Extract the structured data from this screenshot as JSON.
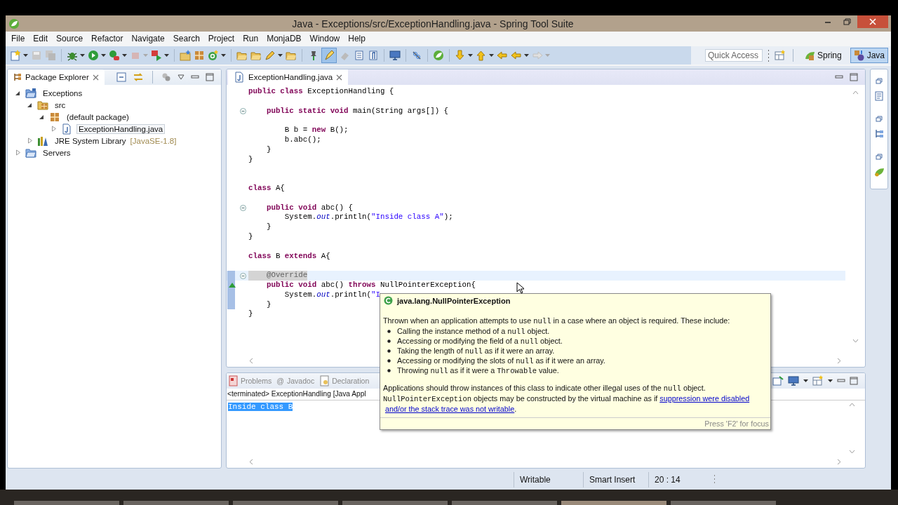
{
  "window": {
    "title": "Java - Exceptions/src/ExceptionHandling.java - Spring Tool Suite"
  },
  "menu": [
    "File",
    "Edit",
    "Source",
    "Refactor",
    "Navigate",
    "Search",
    "Project",
    "Run",
    "MonjaDB",
    "Window",
    "Help"
  ],
  "toolbar": {
    "quick_access": {
      "placeholder": "Quick Access"
    },
    "perspectives": [
      {
        "label": "Spring",
        "kind": "spring",
        "selected": false
      },
      {
        "label": "Java",
        "kind": "java",
        "selected": true
      }
    ]
  },
  "package_explorer": {
    "title": "Package Explorer",
    "tree": [
      {
        "label": "Exceptions",
        "kind": "project",
        "expanded": true,
        "selected": false,
        "children": [
          {
            "label": "src",
            "kind": "source-folder",
            "expanded": true,
            "selected": false,
            "children": [
              {
                "label": "(default package)",
                "kind": "package",
                "expanded": true,
                "selected": false,
                "children": [
                  {
                    "label": "ExceptionHandling.java",
                    "kind": "java-file",
                    "expanded": false,
                    "selected": true
                  }
                ]
              }
            ]
          },
          {
            "label": "JRE System Library",
            "decoration": "[JavaSE-1.8]",
            "kind": "library",
            "expanded": false,
            "selected": false
          }
        ]
      },
      {
        "label": "Servers",
        "kind": "folder",
        "expanded": false,
        "selected": false
      }
    ]
  },
  "editor": {
    "tab": "ExceptionHandling.java",
    "lines": [
      {
        "kind": "code",
        "fold": false,
        "changed": false,
        "current": false,
        "tokens": [
          {
            "kind": "keyword",
            "text": "public class"
          },
          {
            "kind": "plain",
            "text": " ExceptionHandling {"
          }
        ]
      },
      {
        "kind": "blank"
      },
      {
        "kind": "code",
        "fold": true,
        "changed": false,
        "current": false,
        "tokens": [
          {
            "kind": "keyword",
            "text": "    public static void"
          },
          {
            "kind": "plain",
            "text": " main(String args[]) {"
          }
        ]
      },
      {
        "kind": "blank"
      },
      {
        "kind": "code",
        "fold": false,
        "changed": false,
        "current": false,
        "tokens": [
          {
            "kind": "plain",
            "text": "        B b = "
          },
          {
            "kind": "keyword",
            "text": "new"
          },
          {
            "kind": "plain",
            "text": " B();"
          }
        ]
      },
      {
        "kind": "code",
        "fold": false,
        "changed": false,
        "current": false,
        "tokens": [
          {
            "kind": "plain",
            "text": "        b.abc();"
          }
        ]
      },
      {
        "kind": "code",
        "fold": false,
        "changed": false,
        "current": false,
        "tokens": [
          {
            "kind": "plain",
            "text": "    }"
          }
        ]
      },
      {
        "kind": "code",
        "fold": false,
        "changed": false,
        "current": false,
        "tokens": [
          {
            "kind": "plain",
            "text": "}"
          }
        ]
      },
      {
        "kind": "blank"
      },
      {
        "kind": "blank"
      },
      {
        "kind": "code",
        "fold": false,
        "changed": false,
        "current": false,
        "tokens": [
          {
            "kind": "keyword",
            "text": "class"
          },
          {
            "kind": "plain",
            "text": " A{"
          }
        ]
      },
      {
        "kind": "blank"
      },
      {
        "kind": "code",
        "fold": true,
        "changed": false,
        "current": false,
        "tokens": [
          {
            "kind": "keyword",
            "text": "    public void"
          },
          {
            "kind": "plain",
            "text": " abc() {"
          }
        ]
      },
      {
        "kind": "code",
        "fold": false,
        "changed": false,
        "current": false,
        "tokens": [
          {
            "kind": "plain",
            "text": "        System."
          },
          {
            "kind": "field",
            "text": "out"
          },
          {
            "kind": "plain",
            "text": ".println("
          },
          {
            "kind": "string",
            "text": "\"Inside class A\""
          },
          {
            "kind": "plain",
            "text": ");"
          }
        ]
      },
      {
        "kind": "code",
        "fold": false,
        "changed": false,
        "current": false,
        "tokens": [
          {
            "kind": "plain",
            "text": "    }"
          }
        ]
      },
      {
        "kind": "code",
        "fold": false,
        "changed": false,
        "current": false,
        "tokens": [
          {
            "kind": "plain",
            "text": "}"
          }
        ]
      },
      {
        "kind": "blank"
      },
      {
        "kind": "code",
        "fold": false,
        "changed": false,
        "current": false,
        "tokens": [
          {
            "kind": "keyword",
            "text": "class"
          },
          {
            "kind": "plain",
            "text": " B "
          },
          {
            "kind": "keyword",
            "text": "extends"
          },
          {
            "kind": "plain",
            "text": " A{"
          }
        ]
      },
      {
        "kind": "blank"
      },
      {
        "kind": "code",
        "fold": true,
        "changed": true,
        "current": true,
        "tokens": [
          {
            "kind": "annotation",
            "text": "    @Override"
          }
        ]
      },
      {
        "kind": "code",
        "fold": false,
        "changed": true,
        "current": false,
        "overrides": true,
        "tokens": [
          {
            "kind": "keyword",
            "text": "    public void"
          },
          {
            "kind": "plain",
            "text": " abc() "
          },
          {
            "kind": "keyword",
            "text": "throws"
          },
          {
            "kind": "plain",
            "text": " NullPointerException{"
          }
        ]
      },
      {
        "kind": "code",
        "fold": false,
        "changed": true,
        "current": false,
        "tokens": [
          {
            "kind": "plain",
            "text": "        System."
          },
          {
            "kind": "field",
            "text": "out"
          },
          {
            "kind": "plain",
            "text": ".println("
          },
          {
            "kind": "string",
            "text": "\"I"
          }
        ]
      },
      {
        "kind": "code",
        "fold": false,
        "changed": true,
        "current": false,
        "tokens": [
          {
            "kind": "plain",
            "text": "    }"
          }
        ]
      },
      {
        "kind": "code",
        "fold": false,
        "changed": false,
        "current": false,
        "tokens": [
          {
            "kind": "plain",
            "text": "}"
          }
        ]
      }
    ]
  },
  "tooltip": {
    "title": "java.lang.NullPointerException",
    "intro": [
      {
        "kind": "text",
        "text": "Thrown when an application attempts to use "
      },
      {
        "kind": "code",
        "text": "null"
      },
      {
        "kind": "text",
        "text": " in a case where an object is required. These include:"
      }
    ],
    "bullets": [
      [
        {
          "kind": "text",
          "text": "Calling the instance method of a "
        },
        {
          "kind": "code",
          "text": "null"
        },
        {
          "kind": "text",
          "text": " object."
        }
      ],
      [
        {
          "kind": "text",
          "text": "Accessing or modifying the field of a "
        },
        {
          "kind": "code",
          "text": "null"
        },
        {
          "kind": "text",
          "text": " object."
        }
      ],
      [
        {
          "kind": "text",
          "text": "Taking the length of "
        },
        {
          "kind": "code",
          "text": "null"
        },
        {
          "kind": "text",
          "text": " as if it were an array."
        }
      ],
      [
        {
          "kind": "text",
          "text": "Accessing or modifying the slots of "
        },
        {
          "kind": "code",
          "text": "null"
        },
        {
          "kind": "text",
          "text": " as if it were an array."
        }
      ],
      [
        {
          "kind": "text",
          "text": "Throwing "
        },
        {
          "kind": "code",
          "text": "null"
        },
        {
          "kind": "text",
          "text": " as if it were a "
        },
        {
          "kind": "code",
          "text": "Throwable"
        },
        {
          "kind": "text",
          "text": " value."
        }
      ]
    ],
    "outro": [
      {
        "kind": "text",
        "text": "Applications should throw instances of this class to indicate other illegal uses of the "
      },
      {
        "kind": "code",
        "text": "null"
      },
      {
        "kind": "text",
        "text": " object. "
      },
      {
        "kind": "code",
        "text": "NullPointerException"
      },
      {
        "kind": "text",
        "text": " objects may be constructed by the virtual machine as if "
      },
      {
        "kind": "link",
        "text": "suppression were disabled"
      },
      {
        "kind": "link",
        "text": "and/or the stack trace was not writable"
      },
      {
        "kind": "text",
        "text": "."
      }
    ],
    "footer": "Press 'F2' for focus"
  },
  "console": {
    "tabs": [
      {
        "label": "Problems",
        "kind": "problems"
      },
      {
        "label": "Javadoc",
        "kind": "javadoc",
        "glyph": "@"
      },
      {
        "label": "Declaration",
        "kind": "declaration"
      }
    ],
    "header": "<terminated> ExceptionHandling [Java Appl",
    "output": "Inside class B",
    "output_selected": true
  },
  "status_bar": [
    "Writable",
    "Smart Insert",
    "20 : 14"
  ]
}
